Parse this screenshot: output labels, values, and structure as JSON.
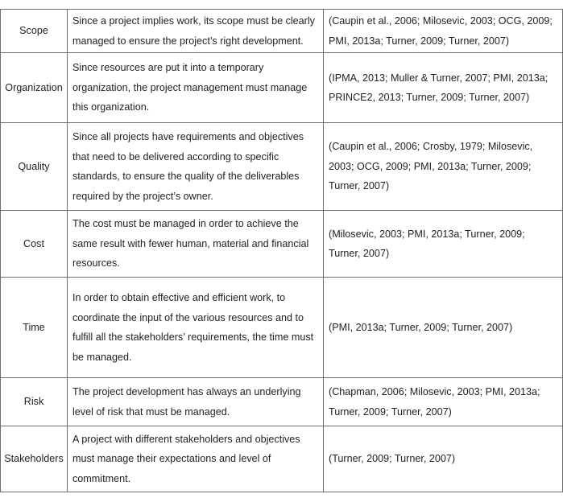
{
  "rows": [
    {
      "dimension": "Scope",
      "description": "Since a project implies work, its scope must be clearly managed to ensure the project’s right development.",
      "references": "(Caupin et al., 2006; Milosevic, 2003; OCG, 2009; PMI, 2013a; Turner, 2009; Turner, 2007)"
    },
    {
      "dimension": "Organization",
      "description": "Since resources are put it into a temporary organization, the project management must manage this organization.",
      "references": "(IPMA, 2013; Muller & Turner, 2007; PMI, 2013a; PRINCE2, 2013; Turner, 2009; Turner, 2007)"
    },
    {
      "dimension": "Quality",
      "description": "Since all projects have requirements and objectives that need to be delivered according to specific standards, to ensure the quality of the deliverables required by the project’s owner.",
      "references": "(Caupin et al., 2006; Crosby, 1979; Milosevic, 2003; OCG, 2009; PMI, 2013a; Turner, 2009; Turner, 2007)"
    },
    {
      "dimension": "Cost",
      "description": "The cost must be managed in order to achieve the same result with fewer human, material and financial resources.",
      "references": "(Milosevic, 2003; PMI, 2013a; Turner, 2009; Turner, 2007)"
    },
    {
      "dimension": "Time",
      "description": "In order to obtain effective and efficient work, to coordinate the input of the various resources and to fulfill all the stakeholders’ requirements, the time must be managed.",
      "references": "(PMI, 2013a; Turner, 2009; Turner, 2007)"
    },
    {
      "dimension": "Risk",
      "description": "The project development has always an underlying level of risk that must be managed.",
      "references": "(Chapman, 2006; Milosevic, 2003; PMI, 2013a; Turner, 2009; Turner, 2007)"
    },
    {
      "dimension": "Stakeholders",
      "description": "A project with different stakeholders and objectives must manage their expectations and level of commitment.",
      "references": "(Turner, 2009; Turner, 2007)"
    }
  ]
}
